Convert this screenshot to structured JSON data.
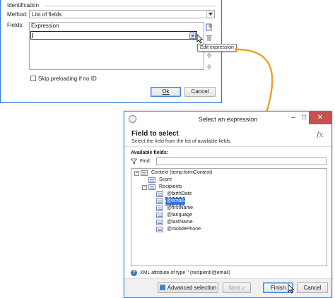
{
  "dialog_top": {
    "section_title": "Identification",
    "method_label": "Method:",
    "method_value": "List of fields",
    "fields_label": "Fields:",
    "column_header": "Expression",
    "tooltip": "Edit expression",
    "skip_checkbox_label": "Skip preloading if no ID",
    "skip_checked": false,
    "ok_label": "Ok",
    "cancel_label": "Cancel"
  },
  "dialog_select": {
    "window_title": "Select an expression",
    "heading": "Field to select",
    "subheading": "Select the field from the list of available fields.",
    "fx_label": "fx",
    "available_label": "Available fields:",
    "find_label": "Find:",
    "find_value": "",
    "tree": {
      "root": "Context (temp:formContext)",
      "score": "Score",
      "recipients": "Recipients",
      "children": [
        "@birthDate",
        "@email",
        "@firstName",
        "@language",
        "@lastName",
        "@mobilePhone"
      ],
      "selected": "@email"
    },
    "status_text": "XML attribute of type '' (recipient/@email)",
    "advanced_label": "Advanced selection",
    "next_label": "Next >",
    "finish_label": "Finish",
    "cancel_label": "Cancel"
  },
  "colors": {
    "accent_orange": "#f0a020",
    "selection_blue": "#3275d6",
    "window_border": "#3f80dc",
    "close_red": "#c75050"
  }
}
